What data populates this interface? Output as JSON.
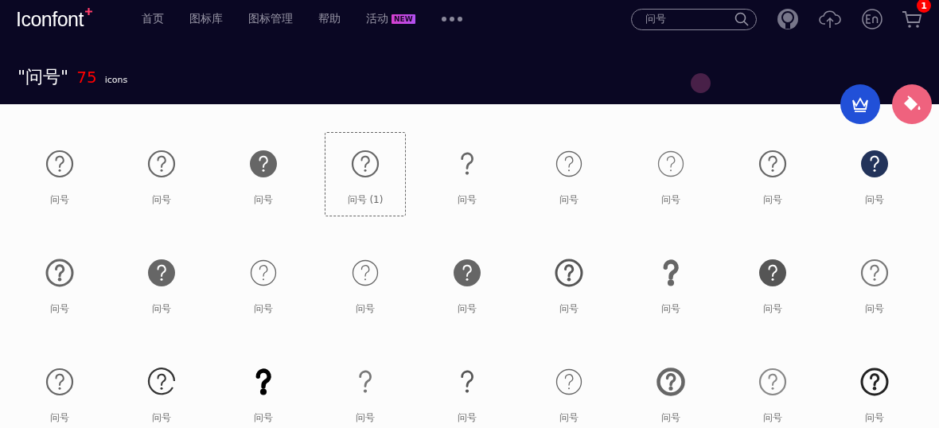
{
  "header": {
    "logo": "Iconfont",
    "nav": [
      {
        "label": "首页"
      },
      {
        "label": "图标库"
      },
      {
        "label": "图标管理"
      },
      {
        "label": "帮助"
      },
      {
        "label": "活动",
        "badge": "NEW"
      }
    ],
    "search": {
      "value": "问号"
    },
    "cart_count": "1"
  },
  "result": {
    "query": "\"问号\"",
    "count": "75",
    "unit": "icons"
  },
  "icons": [
    {
      "label": "问号",
      "kind": "ring",
      "color": "#666666",
      "selected": false
    },
    {
      "label": "问号",
      "kind": "ring",
      "color": "#666666",
      "selected": false
    },
    {
      "label": "问号",
      "kind": "disc",
      "color": "#666666",
      "selected": false
    },
    {
      "label": "问号 (1)",
      "kind": "ring",
      "color": "#666666",
      "selected": true
    },
    {
      "label": "问号",
      "kind": "bare",
      "color": "#666666",
      "selected": false
    },
    {
      "label": "问号",
      "kind": "thin",
      "color": "#666666",
      "selected": false
    },
    {
      "label": "问号",
      "kind": "thin",
      "color": "#777777",
      "selected": false
    },
    {
      "label": "问号",
      "kind": "ring",
      "color": "#666666",
      "selected": false
    },
    {
      "label": "问号",
      "kind": "disc",
      "color": "#22335a",
      "selected": false
    },
    {
      "label": "问号",
      "kind": "bold",
      "color": "#666666",
      "selected": false
    },
    {
      "label": "问号",
      "kind": "disc",
      "color": "#666666",
      "selected": false
    },
    {
      "label": "问号",
      "kind": "thin",
      "color": "#666666",
      "selected": false
    },
    {
      "label": "问号",
      "kind": "thin",
      "color": "#666666",
      "selected": false
    },
    {
      "label": "问号",
      "kind": "disc",
      "color": "#666666",
      "selected": false
    },
    {
      "label": "问号",
      "kind": "bold",
      "color": "#555555",
      "selected": false
    },
    {
      "label": "问号",
      "kind": "bare-bold",
      "color": "#666666",
      "selected": false
    },
    {
      "label": "问号",
      "kind": "disc",
      "color": "#555555",
      "selected": false
    },
    {
      "label": "问号",
      "kind": "ring",
      "color": "#777777",
      "selected": false
    },
    {
      "label": "问号",
      "kind": "ring",
      "color": "#666666",
      "selected": false
    },
    {
      "label": "问号",
      "kind": "broken",
      "color": "#333333",
      "selected": false
    },
    {
      "label": "问号",
      "kind": "bare-bold",
      "color": "#000000",
      "selected": false
    },
    {
      "label": "问号",
      "kind": "bare",
      "color": "#777777",
      "selected": false
    },
    {
      "label": "问号",
      "kind": "bare",
      "color": "#555555",
      "selected": false
    },
    {
      "label": "问号",
      "kind": "thin",
      "color": "#666666",
      "selected": false
    },
    {
      "label": "问号",
      "kind": "heavy",
      "color": "#666666",
      "selected": false
    },
    {
      "label": "问号",
      "kind": "ring",
      "color": "#888888",
      "selected": false
    },
    {
      "label": "问号",
      "kind": "bold",
      "color": "#222222",
      "selected": false
    }
  ]
}
